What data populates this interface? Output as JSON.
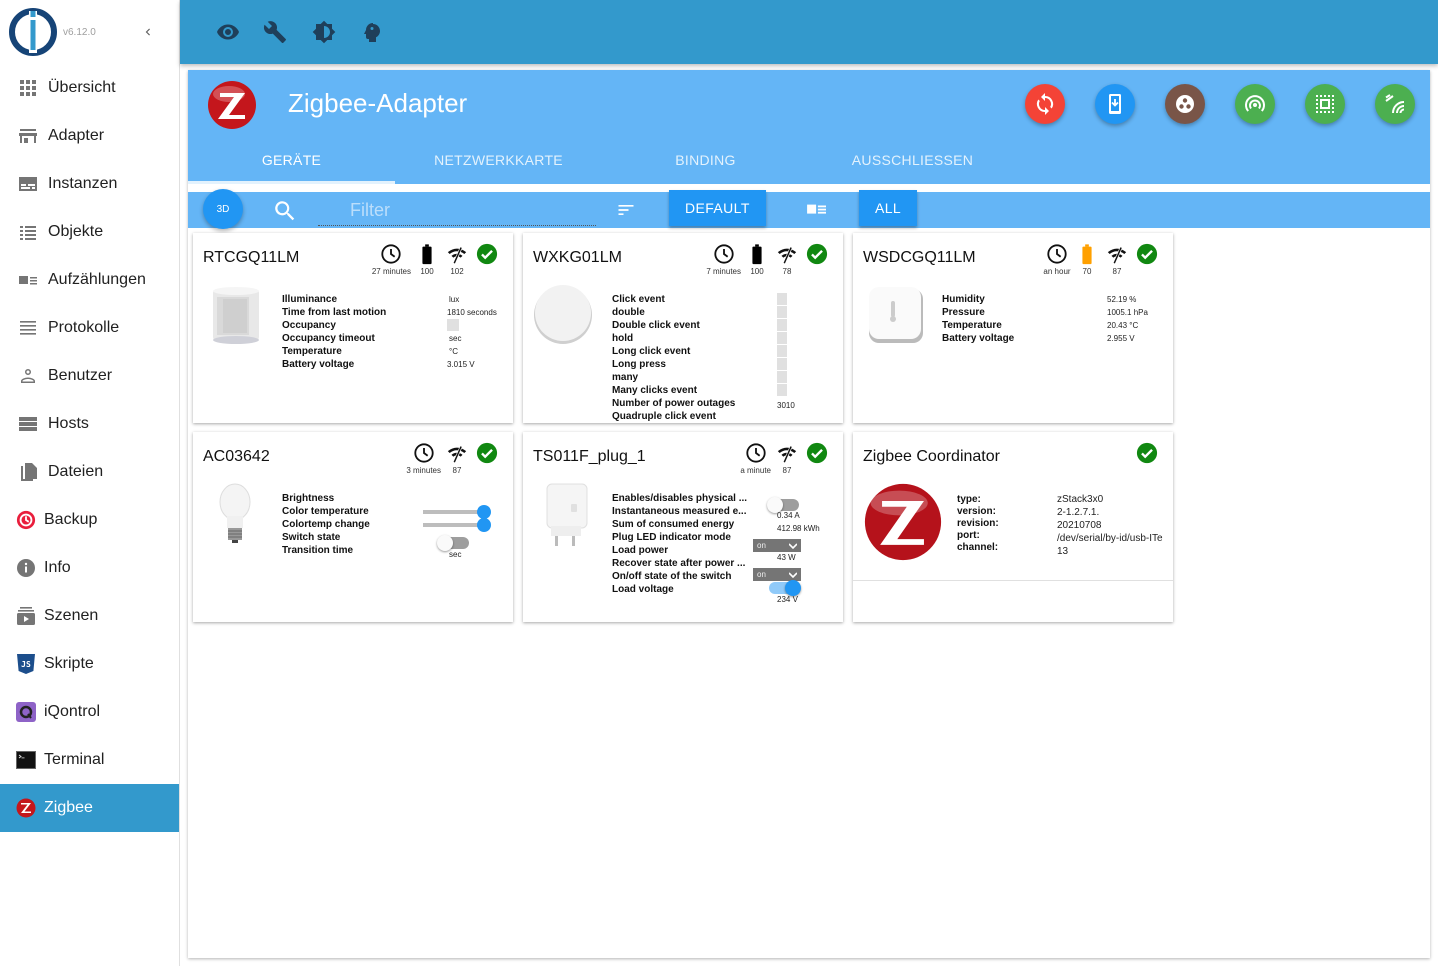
{
  "app": {
    "version": "v6.12.0"
  },
  "sidebar": {
    "items": [
      {
        "label": "Übersicht",
        "icon": "apps-icon"
      },
      {
        "label": "Adapter",
        "icon": "store-icon"
      },
      {
        "label": "Instanzen",
        "icon": "subtitles-icon"
      },
      {
        "label": "Objekte",
        "icon": "list-icon"
      },
      {
        "label": "Aufzählungen",
        "icon": "enum-icon"
      },
      {
        "label": "Protokolle",
        "icon": "log-icon"
      },
      {
        "label": "Benutzer",
        "icon": "person-icon"
      },
      {
        "label": "Hosts",
        "icon": "storage-icon"
      },
      {
        "label": "Dateien",
        "icon": "files-icon"
      },
      {
        "label": "Backup",
        "icon": "backup-icon"
      },
      {
        "label": "Info",
        "icon": "info-icon"
      },
      {
        "label": "Szenen",
        "icon": "scenes-icon"
      },
      {
        "label": "Skripte",
        "icon": "javascript-icon"
      },
      {
        "label": "iQontrol",
        "icon": "iqontrol-icon"
      },
      {
        "label": "Terminal",
        "icon": "terminal-icon"
      },
      {
        "label": "Zigbee",
        "icon": "zigbee-icon",
        "active": true
      }
    ]
  },
  "topbar": {
    "icons": [
      "eye-icon",
      "wrench-icon",
      "brightness-icon",
      "expert-mode-icon"
    ]
  },
  "adapter": {
    "title": "Zigbee-Adapter",
    "tabs": [
      "GERÄTE",
      "NETZWERKKARTE",
      "BINDING",
      "AUSSCHLIESSEN"
    ],
    "active_tab": "GERÄTE",
    "actions": [
      {
        "name": "refresh-button",
        "icon": "sync-icon",
        "color": "#f44336"
      },
      {
        "name": "install-code-button",
        "icon": "device-download-icon",
        "color": "#2196f3"
      },
      {
        "name": "groups-button",
        "icon": "groups-icon",
        "color": "#795548"
      },
      {
        "name": "touchlink-button",
        "icon": "wifi-tethering-icon",
        "color": "#4caf50"
      },
      {
        "name": "select-all-button",
        "icon": "select-all-icon",
        "color": "#4caf50"
      },
      {
        "name": "pairing-button",
        "icon": "leak-icon",
        "color": "#4caf50"
      }
    ]
  },
  "toolbar": {
    "btn_3d": "3D",
    "filter_placeholder": "Filter",
    "filter_value": "",
    "default_label": "DEFAULT",
    "all_label": "ALL"
  },
  "devices": [
    {
      "name": "RTCGQ11LM",
      "last_seen": "27 minutes",
      "battery": "100",
      "battery_color": "#000000",
      "link_quality": "102",
      "props": [
        "Illuminance",
        "Time from last motion",
        "Occupancy",
        "Occupancy timeout",
        "Temperature",
        "Battery voltage"
      ],
      "vals": [
        "lux",
        "1810 seconds",
        "",
        "sec",
        "°C",
        "3.015 V"
      ]
    },
    {
      "name": "WXKG01LM",
      "last_seen": "7 minutes",
      "battery": "100",
      "battery_color": "#000000",
      "link_quality": "78",
      "props": [
        "Click event",
        "double",
        "Double click event",
        "hold",
        "Long click event",
        "Long press",
        "many",
        "Many clicks event",
        "Number of power outages",
        "Quadruple click event"
      ],
      "vals": [
        "",
        "",
        "",
        "",
        "",
        "",
        "",
        "",
        "3010",
        ""
      ]
    },
    {
      "name": "WSDCGQ11LM",
      "last_seen": "an hour",
      "battery": "70",
      "battery_color": "#ffa000",
      "link_quality": "87",
      "props": [
        "Humidity",
        "Pressure",
        "Temperature",
        "Battery voltage"
      ],
      "vals": [
        "52.19 %",
        "1005.1 hPa",
        "20.43 °C",
        "2.955 V"
      ]
    },
    {
      "name": "AC03642",
      "last_seen": "3 minutes",
      "link_quality": "87",
      "props": [
        "Brightness",
        "Color temperature",
        "Colortemp change",
        "Switch state",
        "Transition time"
      ],
      "brightness_pct": 100,
      "color_temp_pct": 100,
      "switch_state": false,
      "transition_unit": "sec"
    },
    {
      "name": "TS011F_plug_1",
      "last_seen": "a minute",
      "link_quality": "87",
      "props": [
        "Enables/disables physical ...",
        "Instantaneous measured e...",
        "Sum of consumed energy",
        "Plug LED indicator mode",
        "Load power",
        "Recover state after power ...",
        "On/off state of the switch",
        "Load voltage"
      ],
      "child_lock": false,
      "current": "0.34 A",
      "energy": "412.98 kWh",
      "led_mode": "on",
      "power": "43 W",
      "recover_state": "on",
      "state": true,
      "voltage": "234 V"
    },
    {
      "name": "Zigbee Coordinator",
      "props": [
        "type:",
        "version:",
        "revision:",
        "port:",
        "channel:"
      ],
      "vals": [
        "zStack3x0",
        "2-1.2.7.1.",
        "20210708",
        "/dev/serial/by-id/usb-ITead",
        "13"
      ]
    }
  ]
}
